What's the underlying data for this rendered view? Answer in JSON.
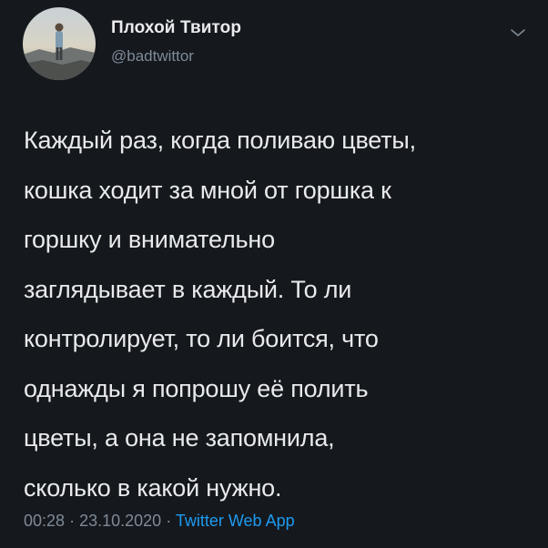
{
  "author": {
    "display_name": "Плохой Твитор",
    "handle": "@badtwittor"
  },
  "menu": {
    "icon": "chevron-down-icon"
  },
  "tweet": {
    "text": "Каждый раз, когда поливаю цветы,\nкошка ходит за мной от горшка к\nгоршку и внимательно\nзаглядывает в каждый. То ли\nконтролирует, то ли боится, что\nоднажды я попрошу её полить\nцветы, а она не запомнила,\nсколько в какой нужно.",
    "time": "00:28",
    "separator": "·",
    "date": "23.10.2020",
    "source": "Twitter Web App"
  },
  "colors": {
    "background": "#15181d",
    "text": "#e8eaec",
    "muted": "#7f8a95",
    "link": "#1d9bf0"
  }
}
